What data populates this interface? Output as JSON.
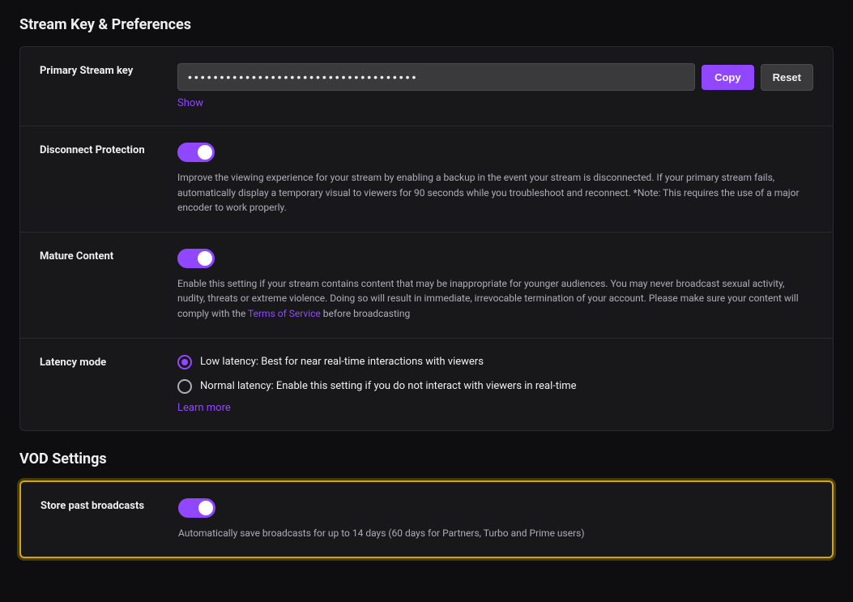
{
  "page": {
    "title": "Stream Key & Preferences",
    "vod_title": "VOD Settings"
  },
  "stream_key": {
    "label": "Primary Stream key",
    "placeholder": "••••••••••••••••••••••••••••••••••••",
    "value": "••••••••••••••••••••••••••••••••••••",
    "copy_label": "Copy",
    "reset_label": "Reset",
    "show_label": "Show"
  },
  "disconnect_protection": {
    "label": "Disconnect Protection",
    "description": "Improve the viewing experience for your stream by enabling a backup in the event your stream is disconnected. If your primary stream fails, automatically display a temporary visual to viewers for 90 seconds while you troubleshoot and reconnect. *Note: This requires the use of a major encoder to work properly.",
    "enabled": true
  },
  "mature_content": {
    "label": "Mature Content",
    "description_before": "Enable this setting if your stream contains content that may be inappropriate for younger audiences. You may never broadcast sexual activity, nudity, threats or extreme violence. Doing so will result in immediate, irrevocable termination of your account. Please make sure your content will comply with the ",
    "terms_label": "Terms of Service",
    "description_after": " before broadcasting",
    "enabled": true
  },
  "latency_mode": {
    "label": "Latency mode",
    "options": [
      {
        "value": "low",
        "label": "Low latency: Best for near real-time interactions with viewers",
        "selected": true
      },
      {
        "value": "normal",
        "label": "Normal latency: Enable this setting if you do not interact with viewers in real-time",
        "selected": false
      }
    ],
    "learn_more_label": "Learn more"
  },
  "store_broadcasts": {
    "label": "Store past broadcasts",
    "description": "Automatically save broadcasts for up to 14 days (60 days for Partners, Turbo and Prime users)",
    "enabled": true
  }
}
